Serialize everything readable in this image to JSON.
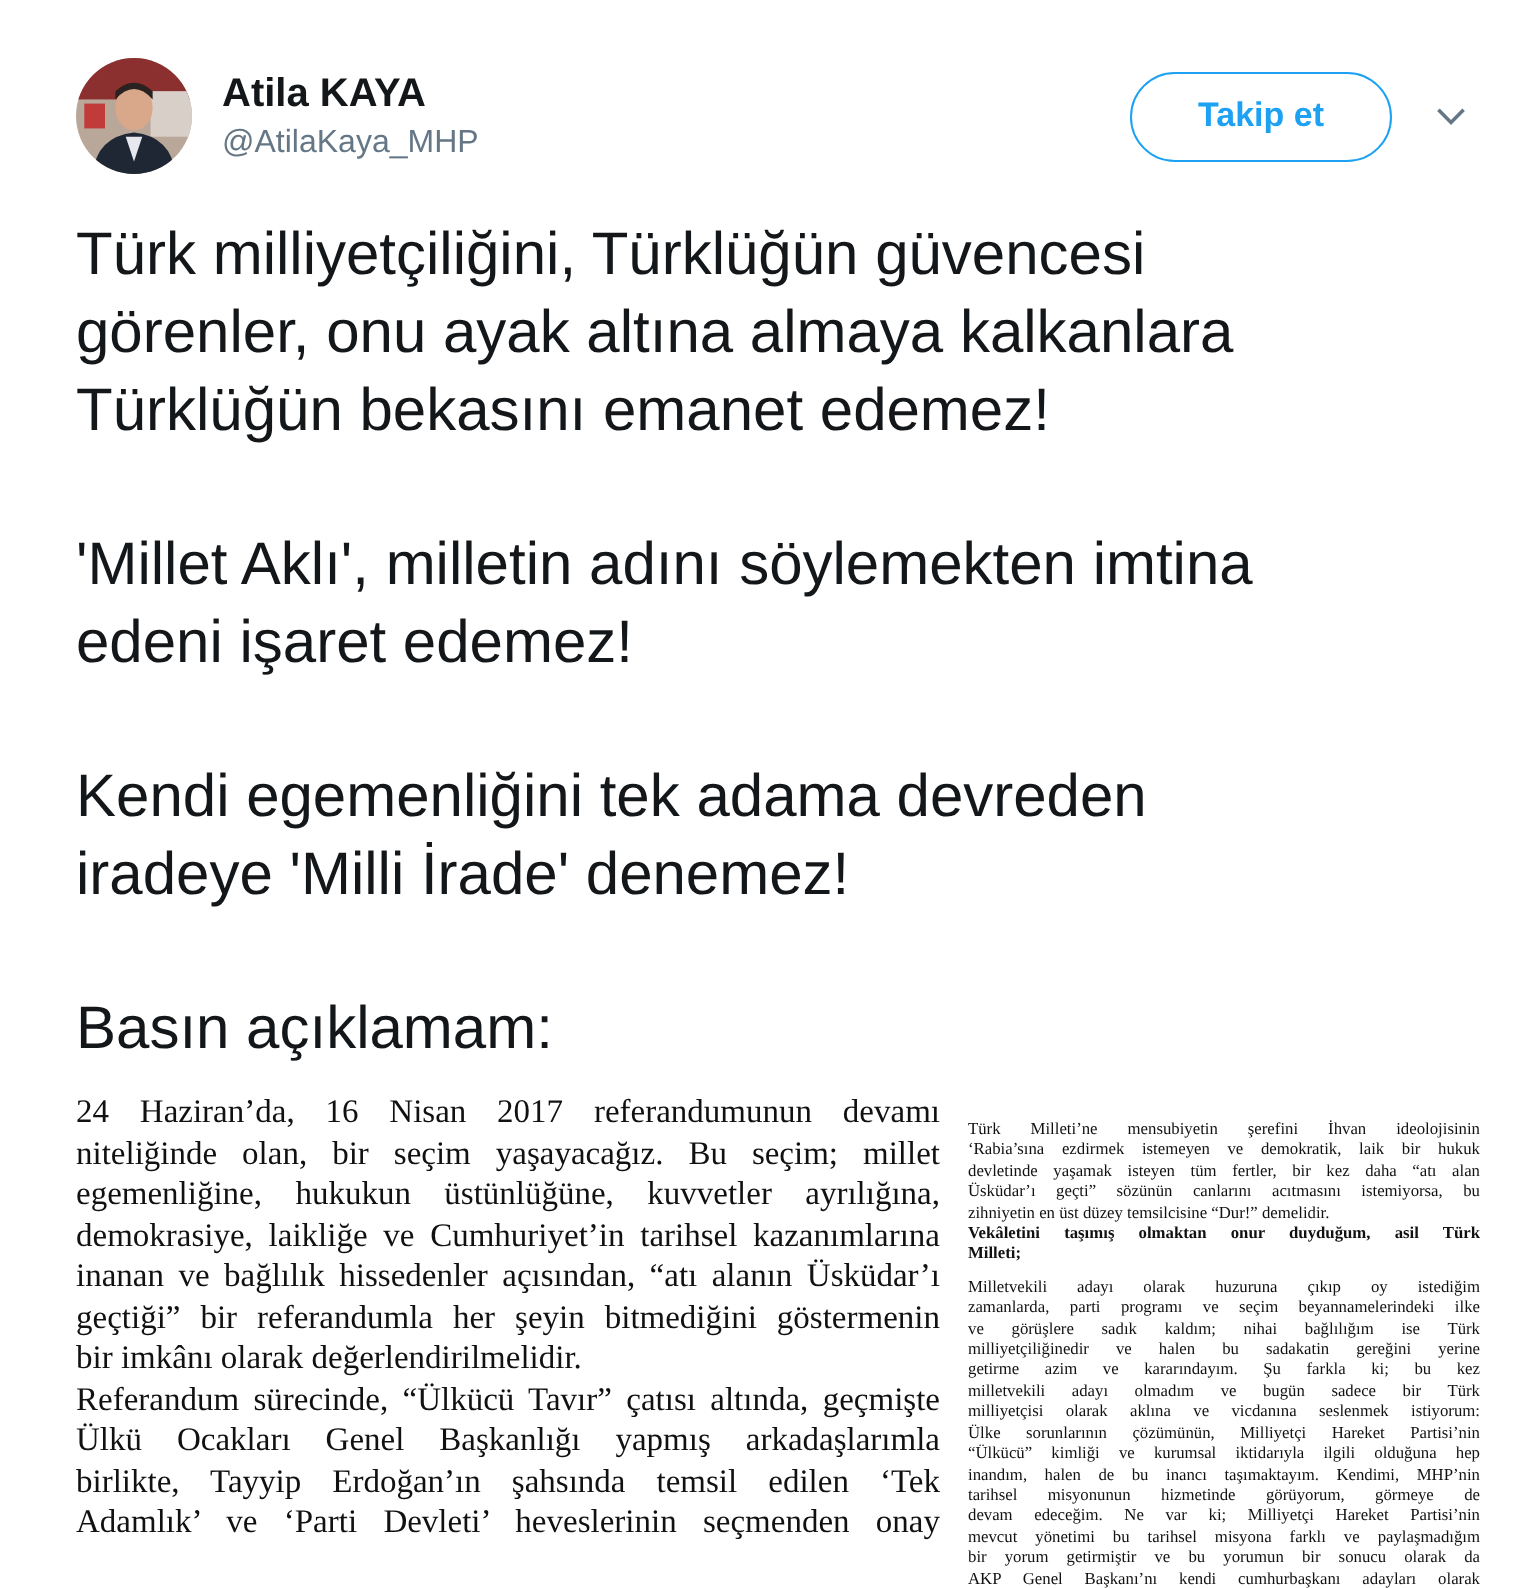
{
  "author": {
    "name": "Atila KAYA",
    "handle": "@AtilaKaya_MHP"
  },
  "follow_button": {
    "label": "Takip et"
  },
  "tweet_text": [
    {
      "lines": [
        "Türk milliyetçiliğini, Türklüğün güvencesi",
        "görenler, onu ayak altına almaya kalkanlara",
        "Türklüğün bekasını emanet edemez!"
      ]
    },
    {
      "lines": [
        "'Millet Aklı', milletin adını söylemekten imtina",
        "edeni işaret edemez!"
      ]
    },
    {
      "lines": [
        "Kendi egemenliğini tek adama devreden",
        "iradeye 'Milli İrade' denemez!"
      ]
    },
    {
      "lines": [
        "Basın açıklamam:"
      ]
    }
  ],
  "documents": [
    {
      "lines": [
        {
          "text": "24 Haziran’da, 16 Nisan 2017 referandumunun devamı",
          "kind": "justify"
        },
        {
          "text": "niteliğinde olan, bir seçim yaşayacağız. Bu seçim; millet",
          "kind": "justify"
        },
        {
          "text": "egemenliğine, hukukun üstünlüğüne, kuvvetler ayrılığına,",
          "kind": "justify"
        },
        {
          "text": "demokrasiye, laikliğe ve Cumhuriyet’in tarihsel kazanımlarına",
          "kind": "justify"
        },
        {
          "text": "inanan ve bağlılık hissedenler açısından, “atı alanın Üsküdar’ı",
          "kind": "justify"
        },
        {
          "text": "geçtiği” bir referandumla her şeyin bitmediğini göstermenin",
          "kind": "justify"
        },
        {
          "text": "bir imkânı olarak değerlendirilmelidir.",
          "kind": "end"
        },
        {
          "text": "Referandum sürecinde, “Ülkücü Tavır” çatısı altında, geçmişte",
          "kind": "justify"
        },
        {
          "text": "Ülkü Ocakları Genel Başkanlığı yapmış arkadaşlarımla",
          "kind": "justify"
        },
        {
          "text": "birlikte, Tayyip Erdoğan’ın şahsında temsil edilen ‘Tek",
          "kind": "justify"
        },
        {
          "text": "Adamlık’ ve ‘Parti Devleti’ heveslerinin seçmenden onay",
          "kind": "justify"
        }
      ]
    },
    {
      "lines": [
        {
          "text": "Türk Milleti’ne mensubiyetin şerefini İhvan ideolojisinin",
          "kind": "justify"
        },
        {
          "text": "‘Rabia’sına ezdirmek istemeyen ve demokratik, laik bir hukuk",
          "kind": "justify"
        },
        {
          "text": "devletinde yaşamak isteyen tüm fertler, bir kez daha “atı alan",
          "kind": "justify"
        },
        {
          "text": "Üsküdar’ı geçti” sözünün canlarını acıtmasını istemiyorsa, bu",
          "kind": "justify"
        },
        {
          "text": "zihniyetin en üst düzey temsilcisine “Dur!” demelidir.",
          "kind": "end"
        },
        {
          "text": "Vekâletini taşımış olmaktan onur duyduğum, asil Türk",
          "kind": "bold"
        },
        {
          "text": "Milleti;",
          "kind": "bold_end"
        },
        {
          "text": "Milletvekili adayı olarak huzuruna çıkıp oy istediğim",
          "kind": "justify"
        },
        {
          "text": "zamanlarda, parti programı ve seçim beyannamelerindeki ilke",
          "kind": "justify"
        },
        {
          "text": "ve görüşlere sadık kaldım; nihai bağlılığım ise Türk",
          "kind": "justify"
        },
        {
          "text": "milliyetçiliğinedir ve halen bu sadakatin gereğini yerine",
          "kind": "justify"
        },
        {
          "text": "getirme azim ve kararındayım. Şu farkla ki; bu kez",
          "kind": "justify"
        },
        {
          "text": "milletvekili adayı olmadım ve bugün sadece bir Türk",
          "kind": "justify"
        },
        {
          "text": "milliyetçisi olarak aklına ve vicdanına seslenmek istiyorum:",
          "kind": "justify"
        },
        {
          "text": "Ülke sorunlarının çözümünün, Milliyetçi Hareket Partisi’nin",
          "kind": "justify"
        },
        {
          "text": "“Ülkücü” kimliği ve kurumsal iktidarıyla ilgili olduğuna hep",
          "kind": "justify"
        },
        {
          "text": "inandım, halen de bu inancı taşımaktayım. Kendimi, MHP’nin",
          "kind": "justify"
        },
        {
          "text": "tarihsel misyonunun hizmetinde görüyorum, görmeye de",
          "kind": "justify"
        },
        {
          "text": "devam edeceğim. Ne var ki; Milliyetçi Hareket Partisi’nin",
          "kind": "justify"
        },
        {
          "text": "mevcut yönetimi bu tarihsel misyona farklı ve paylaşmadığım",
          "kind": "justify"
        },
        {
          "text": "bir yorum getirmiştir ve bu yorumun bir sonucu olarak da",
          "kind": "justify"
        },
        {
          "text": "AKP Genel Başkanı’nı kendi cumhurbaşkanı adayları olarak",
          "kind": "justify"
        }
      ]
    }
  ]
}
